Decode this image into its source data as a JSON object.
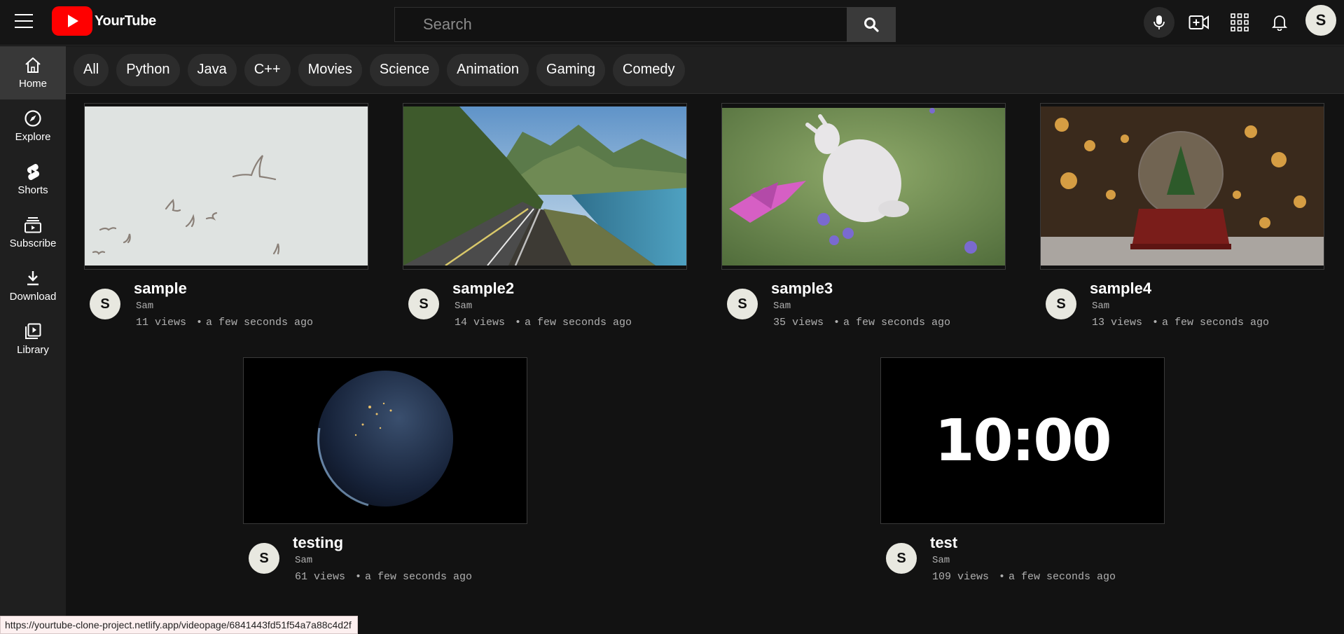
{
  "app": {
    "logo_text": "YourTube"
  },
  "search": {
    "placeholder": "Search"
  },
  "header": {
    "avatar_letter": "S"
  },
  "sidebar": {
    "items": [
      {
        "label": "Home",
        "icon": "home-icon",
        "active": true
      },
      {
        "label": "Explore",
        "icon": "compass-icon"
      },
      {
        "label": "Shorts",
        "icon": "shorts-icon"
      },
      {
        "label": "Subscribe",
        "icon": "subscriptions-icon"
      },
      {
        "label": "Download",
        "icon": "download-icon"
      },
      {
        "label": "Library",
        "icon": "library-icon"
      }
    ]
  },
  "chips": [
    "All",
    "Python",
    "Java",
    "C++",
    "Movies",
    "Science",
    "Animation",
    "Gaming",
    "Comedy"
  ],
  "videos": [
    {
      "title": "sample",
      "channel": "Sam",
      "views": "11 views",
      "age": "a few seconds ago",
      "avatar": "S",
      "thumb": "birds"
    },
    {
      "title": "sample2",
      "channel": "Sam",
      "views": "14 views",
      "age": "a few seconds ago",
      "avatar": "S",
      "thumb": "coast-road"
    },
    {
      "title": "sample3",
      "channel": "Sam",
      "views": "35 views",
      "age": "a few seconds ago",
      "avatar": "S",
      "thumb": "bunny"
    },
    {
      "title": "sample4",
      "channel": "Sam",
      "views": "13 views",
      "age": "a few seconds ago",
      "avatar": "S",
      "thumb": "snow-globe"
    },
    {
      "title": "testing",
      "channel": "Sam",
      "views": "61 views",
      "age": "a few seconds ago",
      "avatar": "S",
      "thumb": "earth"
    },
    {
      "title": "test",
      "channel": "Sam",
      "views": "109 views",
      "age": "a few seconds ago",
      "avatar": "S",
      "thumb": "timer",
      "thumb_text": "10:00"
    }
  ],
  "status_url": "https://yourtube-clone-project.netlify.app/videopage/6841443fd51f54a7a88c4d2f",
  "colors": {
    "accent": "#ff0000",
    "background": "#121212",
    "sidebar": "#1f1f1f"
  }
}
